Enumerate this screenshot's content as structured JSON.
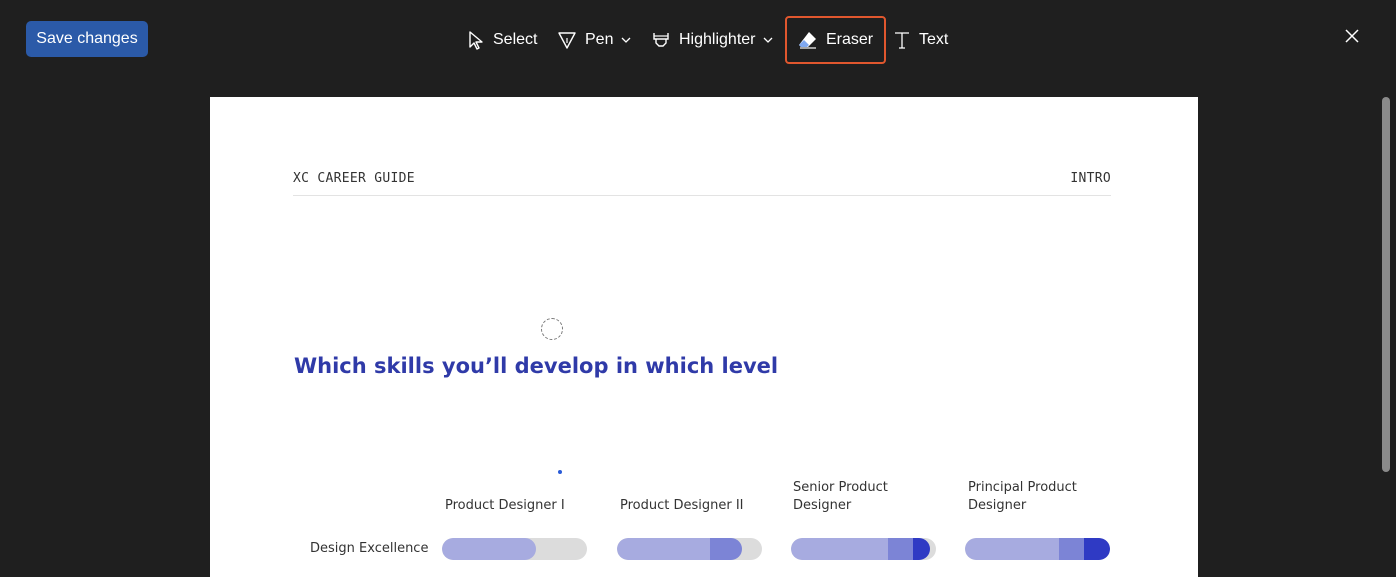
{
  "toolbar": {
    "save_label": "Save changes",
    "tools": {
      "select": "Select",
      "pen": "Pen",
      "highlighter": "Highlighter",
      "eraser": "Eraser",
      "text": "Text"
    },
    "active_tool": "eraser"
  },
  "icons": {
    "select": "pointer-icon",
    "pen": "pen-icon",
    "highlighter": "highlighter-icon",
    "eraser": "eraser-icon",
    "text": "text-icon",
    "close": "close-icon"
  },
  "colors": {
    "accent": "#2b5aa8",
    "active_outline": "#e0572e",
    "heading": "#2f3aa8",
    "bar_track": "#dcdcdc",
    "bar_level1": "#a7abe0",
    "bar_level2": "#7c84d6",
    "bar_level3": "#2f3ac4"
  },
  "document": {
    "header_left": "XC CAREER GUIDE",
    "header_right": "INTRO",
    "heading": "Which skills you’ll develop in which level",
    "columns": [
      "Product Designer I",
      "Product Designer II",
      "Senior Product Designer",
      "Principal Product Designer"
    ],
    "rows": [
      {
        "label": "Design Excellence",
        "levels": [
          0.65,
          0.86,
          0.96,
          1.0
        ]
      }
    ]
  }
}
